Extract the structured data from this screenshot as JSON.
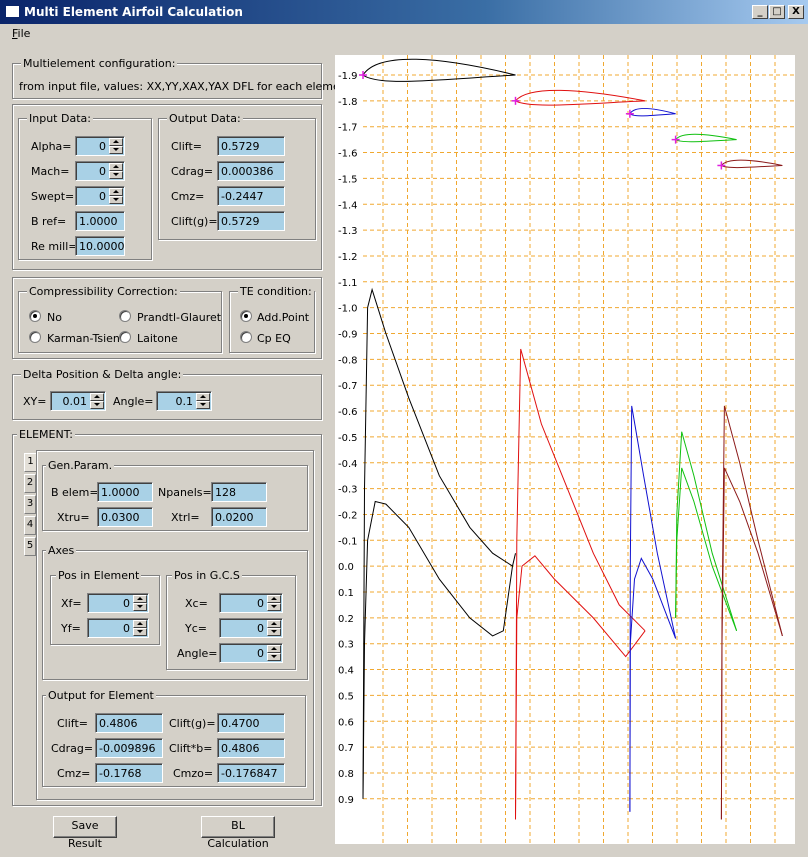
{
  "window": {
    "title": "Multi Element Airfoil Calculation",
    "buttons": {
      "minimize": "_",
      "maximize": "□",
      "close": "X"
    }
  },
  "menu": {
    "file": "File"
  },
  "config": {
    "label": "Multielement configuration:",
    "text": "from input file, values: XX,YY,XAX,YAX DFL for each elements"
  },
  "input_data": {
    "label": "Input Data:",
    "alpha_label": "Alpha=",
    "alpha": "0",
    "mach_label": "Mach=",
    "mach": "0",
    "swept_label": "Swept=",
    "swept": "0",
    "bref_label": "B ref=",
    "bref": "1.0000",
    "remill_label": "Re mill=",
    "remill": "10.0000"
  },
  "output_data": {
    "label": "Output Data:",
    "clift_label": "Clift=",
    "clift": "0.5729",
    "cdrag_label": "Cdrag=",
    "cdrag": "0.000386",
    "cmz_label": "Cmz=",
    "cmz": "-0.2447",
    "cliftg_label": "Clift(g)=",
    "cliftg": "0.5729"
  },
  "compressibility": {
    "label": "Compressibility Correction:",
    "options": [
      "No",
      "Prandtl-Glauret",
      "Karman-Tsien",
      "Laitone"
    ],
    "selected": "No"
  },
  "te_condition": {
    "label": "TE condition:",
    "options": [
      "Add.Point",
      "Cp EQ"
    ],
    "selected": "Add.Point"
  },
  "delta": {
    "label": "Delta Position & Delta angle:",
    "xy_label": "XY=",
    "xy": "0.01",
    "angle_label": "Angle=",
    "angle": "0.1"
  },
  "element": {
    "label": "ELEMENT:",
    "tabs": [
      "1",
      "2",
      "3",
      "4",
      "5"
    ],
    "active_tab": "1",
    "gen_param": {
      "label": "Gen.Param.",
      "belem_label": "B elem=",
      "belem": "1.0000",
      "npanels_label": "Npanels=",
      "npanels": "128",
      "xtru_label": "Xtru=",
      "xtru": "0.0300",
      "xtrl_label": "Xtrl=",
      "xtrl": "0.0200"
    },
    "axes": {
      "label": "Axes",
      "pos_element_label": "Pos in Element",
      "xf_label": "Xf=",
      "xf": "0",
      "yf_label": "Yf=",
      "yf": "0",
      "pos_gcs_label": "Pos in G.C.S",
      "xc_label": "Xc=",
      "xc": "0",
      "yc_label": "Yc=",
      "yc": "0",
      "angle_label": "Angle=",
      "angle": "0"
    },
    "output": {
      "label": "Output for Element",
      "clift_label": "Clift=",
      "clift": "0.4806",
      "cliftg_label": "Clift(g)=",
      "cliftg": "0.4700",
      "cdrag_label": "Cdrag=",
      "cdrag": "-0.009896",
      "cliftb_label": "Clift*b=",
      "cliftb": "0.4806",
      "cmz_label": "Cmz=",
      "cmz": "-0.1768",
      "cmzo_label": "Cmzo=",
      "cmzo": "-0.176847"
    }
  },
  "buttons": {
    "save_result": "Save Result",
    "bl_calculation": "BL Calculation"
  },
  "colors": {
    "field_bg": "#a9d1e6",
    "grid": "#f0a830",
    "element_colors": [
      "#000000",
      "#e01010",
      "#1010d0",
      "#10c010",
      "#8b1a1a"
    ],
    "marker": "#e020e0"
  },
  "chart_data": {
    "type": "line",
    "y_ticks": [
      "-1.9",
      "-1.8",
      "-1.7",
      "-1.6",
      "-1.5",
      "-1.4",
      "-1.3",
      "-1.2",
      "-1.1",
      "-1.0",
      "-0.9",
      "-0.8",
      "-0.7",
      "-0.6",
      "-0.5",
      "-0.4",
      "-0.3",
      "-0.2",
      "-0.1",
      "0.0",
      "0.1",
      "0.2",
      "0.3",
      "0.4",
      "0.5",
      "0.6",
      "0.7",
      "0.8",
      "0.9"
    ],
    "ylim": [
      -1.95,
      1.0
    ],
    "grid": true,
    "y_inverted": true,
    "series": [
      {
        "color": "#000000",
        "cp_upper": [
          [
            0.0,
            0.9
          ],
          [
            0.01,
            -0.3
          ],
          [
            0.03,
            -1.0
          ],
          [
            0.06,
            -1.07
          ],
          [
            0.15,
            -0.9
          ],
          [
            0.3,
            -0.65
          ],
          [
            0.5,
            -0.35
          ],
          [
            0.7,
            -0.15
          ],
          [
            0.85,
            -0.05
          ],
          [
            0.98,
            0.0
          ]
        ],
        "cp_lower": [
          [
            0.0,
            0.9
          ],
          [
            0.01,
            0.3
          ],
          [
            0.03,
            -0.1
          ],
          [
            0.08,
            -0.25
          ],
          [
            0.15,
            -0.24
          ],
          [
            0.3,
            -0.15
          ],
          [
            0.5,
            0.05
          ],
          [
            0.7,
            0.2
          ],
          [
            0.85,
            0.27
          ],
          [
            0.92,
            0.25
          ],
          [
            0.98,
            0.0
          ],
          [
            1.0,
            -0.05
          ]
        ],
        "geometry": {
          "x0": 0.0,
          "x1": 1.0,
          "y": -1.9,
          "thickness": 0.09
        }
      },
      {
        "color": "#e01010",
        "cp_upper": [
          [
            0.0,
            0.98
          ],
          [
            0.01,
            -0.1
          ],
          [
            0.04,
            -0.84
          ],
          [
            0.2,
            -0.55
          ],
          [
            0.4,
            -0.3
          ],
          [
            0.6,
            -0.05
          ],
          [
            0.8,
            0.15
          ],
          [
            1.0,
            0.25
          ]
        ],
        "cp_lower": [
          [
            0.0,
            0.98
          ],
          [
            0.01,
            0.2
          ],
          [
            0.05,
            0.0
          ],
          [
            0.15,
            -0.04
          ],
          [
            0.3,
            0.05
          ],
          [
            0.6,
            0.2
          ],
          [
            0.85,
            0.35
          ],
          [
            1.0,
            0.25
          ]
        ],
        "geometry": {
          "x0": 1.0,
          "x1": 1.85,
          "y": -1.8,
          "thickness": 0.06
        }
      },
      {
        "color": "#1010d0",
        "cp_upper": [
          [
            0.0,
            0.95
          ],
          [
            0.01,
            0.0
          ],
          [
            0.04,
            -0.62
          ],
          [
            0.3,
            -0.35
          ],
          [
            0.6,
            -0.05
          ],
          [
            1.0,
            0.28
          ]
        ],
        "cp_lower": [
          [
            0.0,
            0.95
          ],
          [
            0.01,
            0.3
          ],
          [
            0.1,
            0.05
          ],
          [
            0.25,
            -0.03
          ],
          [
            0.5,
            0.05
          ],
          [
            1.0,
            0.28
          ]
        ],
        "geometry": {
          "x0": 1.75,
          "x1": 2.05,
          "y": -1.75,
          "thickness": 0.03
        }
      },
      {
        "color": "#10c010",
        "cp_upper": [
          [
            0.0,
            0.2
          ],
          [
            0.02,
            -0.2
          ],
          [
            0.1,
            -0.52
          ],
          [
            0.3,
            -0.35
          ],
          [
            0.6,
            -0.05
          ],
          [
            1.0,
            0.25
          ]
        ],
        "cp_lower": [
          [
            0.0,
            0.2
          ],
          [
            0.02,
            -0.1
          ],
          [
            0.1,
            -0.38
          ],
          [
            0.3,
            -0.25
          ],
          [
            0.6,
            0.0
          ],
          [
            1.0,
            0.25
          ]
        ],
        "geometry": {
          "x0": 2.05,
          "x1": 2.45,
          "y": -1.65,
          "thickness": 0.03
        }
      },
      {
        "color": "#8b1a1a",
        "cp_upper": [
          [
            0.0,
            0.98
          ],
          [
            0.01,
            0.2
          ],
          [
            0.05,
            -0.62
          ],
          [
            0.3,
            -0.4
          ],
          [
            0.6,
            -0.1
          ],
          [
            1.0,
            0.27
          ]
        ],
        "cp_lower": [
          [
            0.0,
            0.98
          ],
          [
            0.01,
            0.3
          ],
          [
            0.05,
            -0.38
          ],
          [
            0.3,
            -0.25
          ],
          [
            0.6,
            -0.05
          ],
          [
            1.0,
            0.27
          ]
        ],
        "geometry": {
          "x0": 2.35,
          "x1": 2.75,
          "y": -1.55,
          "thickness": 0.03
        }
      }
    ]
  }
}
